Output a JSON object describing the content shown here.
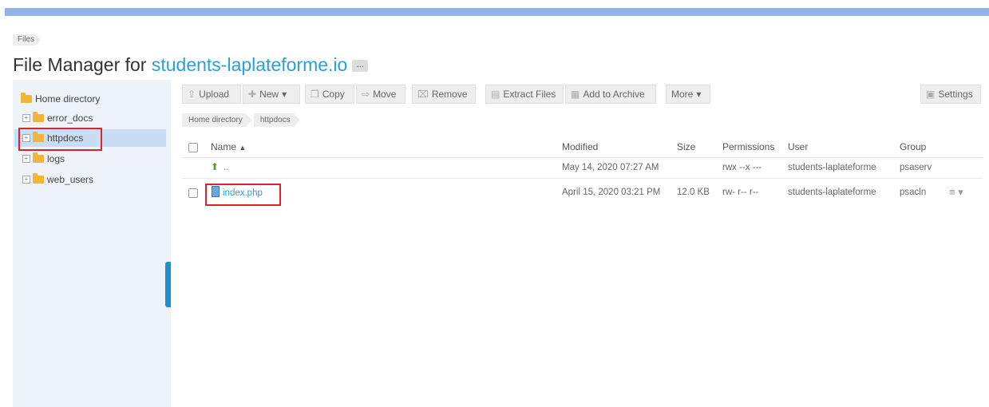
{
  "breadcrumb_top": "Files",
  "title": {
    "prefix": "File Manager for ",
    "domain": "students-laplateforme.io",
    "more_label": "..."
  },
  "toolbar": {
    "upload": "Upload",
    "new": "New",
    "copy": "Copy",
    "move": "Move",
    "remove": "Remove",
    "extract": "Extract Files",
    "archive": "Add to Archive",
    "more": "More",
    "settings": "Settings",
    "dropdown_arrow": "▾"
  },
  "path": [
    "Home directory",
    "httpdocs"
  ],
  "tree": {
    "root": "Home directory",
    "items": [
      "error_docs",
      "httpdocs",
      "logs",
      "web_users"
    ],
    "expander": "+"
  },
  "table": {
    "headers": {
      "name": "Name",
      "sort_arrow": "▲",
      "modified": "Modified",
      "size": "Size",
      "permissions": "Permissions",
      "user": "User",
      "group": "Group"
    },
    "rows": [
      {
        "name": "..",
        "modified": "May 14, 2020 07:27 AM",
        "size": "",
        "permissions": "rwx --x ---",
        "user": "students-laplateforme",
        "group": "psaserv"
      },
      {
        "name": "index.php",
        "modified": "April 15, 2020 03:21 PM",
        "size": "12.0 KB",
        "permissions": "rw- r-- r--",
        "user": "students-laplateforme",
        "group": "psacln",
        "menu": "≡ ▾"
      }
    ]
  },
  "colors": {
    "accent": "#2a9fd8",
    "highlight": "#d9232d",
    "folder": "#f2b53c",
    "sidebar_bg": "#eef3f9"
  }
}
